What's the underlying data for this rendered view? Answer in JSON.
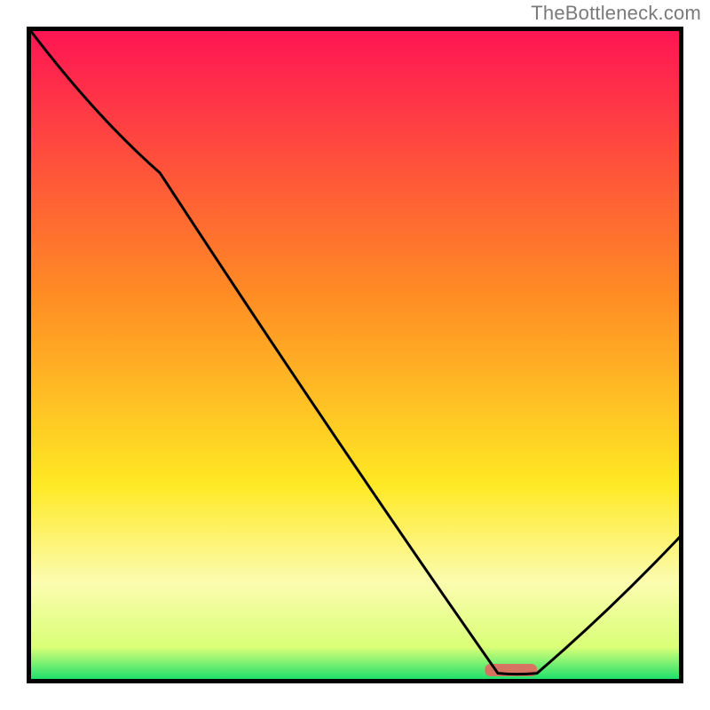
{
  "attribution": "TheBottleneck.com",
  "chart_data": {
    "type": "line",
    "title": "",
    "xlabel": "",
    "ylabel": "",
    "xlim": [
      0,
      100
    ],
    "ylim": [
      0,
      100
    ],
    "x": [
      0,
      20,
      72,
      78,
      100
    ],
    "values": [
      100,
      78,
      1,
      1,
      22
    ],
    "grid": false,
    "legend": false,
    "marker": {
      "x_range": [
        70,
        78
      ],
      "y": 1.5
    },
    "gradient_stops": [
      {
        "pos": 0.0,
        "color": "#ff1554"
      },
      {
        "pos": 0.4,
        "color": "#ff8a24"
      },
      {
        "pos": 0.7,
        "color": "#ffe924"
      },
      {
        "pos": 0.85,
        "color": "#fcfcb0"
      },
      {
        "pos": 0.95,
        "color": "#d9ff77"
      },
      {
        "pos": 1.0,
        "color": "#19e06c"
      }
    ],
    "frame_color": "#000000",
    "line_color": "#000000",
    "marker_color": "#d77361"
  }
}
